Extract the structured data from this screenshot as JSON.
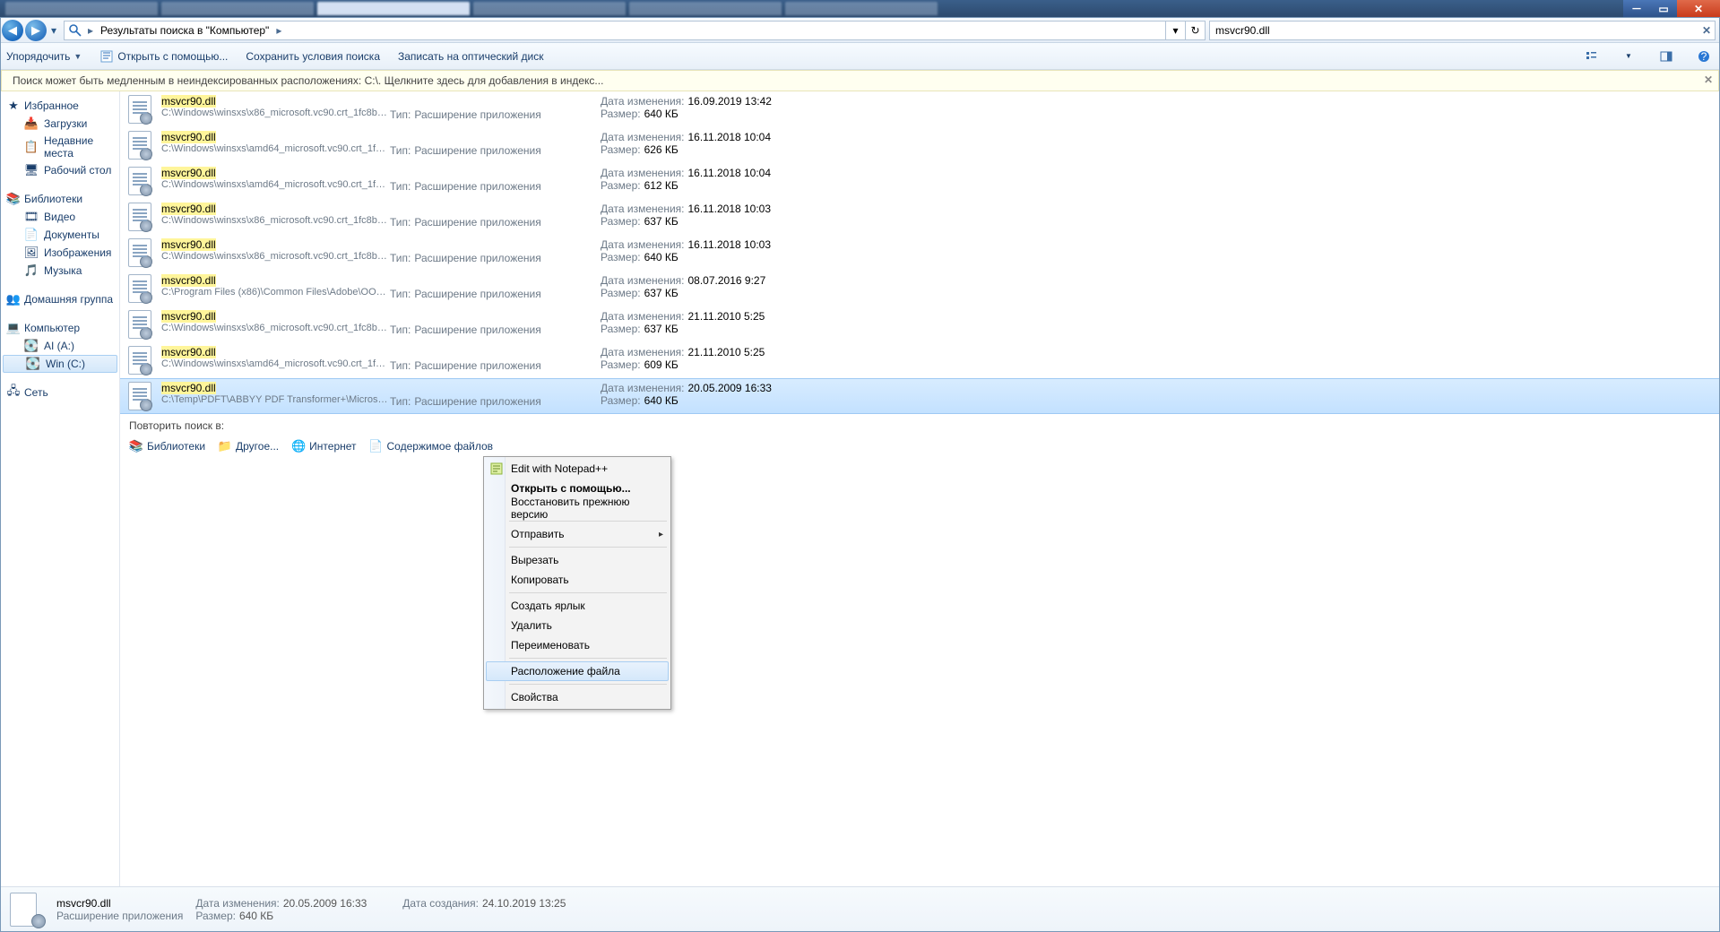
{
  "breadcrumb": {
    "text": "Результаты поиска в \"Компьютер\""
  },
  "search": {
    "value": "msvcr90.dll"
  },
  "toolbar": {
    "organize": "Упорядочить",
    "open_with": "Открыть с помощью...",
    "save_search": "Сохранить условия поиска",
    "burn": "Записать на оптический диск"
  },
  "infobar": {
    "text": "Поиск может быть медленным в неиндексированных расположениях: C:\\. Щелкните здесь для добавления в индекс..."
  },
  "sidebar": {
    "favorites": {
      "label": "Избранное",
      "items": [
        {
          "label": "Загрузки"
        },
        {
          "label": "Недавние места"
        },
        {
          "label": "Рабочий стол"
        }
      ]
    },
    "libraries": {
      "label": "Библиотеки",
      "items": [
        {
          "label": "Видео"
        },
        {
          "label": "Документы"
        },
        {
          "label": "Изображения"
        },
        {
          "label": "Музыка"
        }
      ]
    },
    "homegroup": {
      "label": "Домашняя группа"
    },
    "computer": {
      "label": "Компьютер",
      "items": [
        {
          "label": "AI (A:)"
        },
        {
          "label": "Win (C:)",
          "selected": true
        }
      ]
    },
    "network": {
      "label": "Сеть"
    }
  },
  "type_label": "Тип:",
  "type_value": "Расширение приложения",
  "date_label": "Дата изменения:",
  "size_label": "Размер:",
  "results": [
    {
      "name": "msvcr90.dll",
      "path": "C:\\Windows\\winsxs\\x86_microsoft.vc90.crt_1fc8b3b...",
      "date": "16.09.2019 13:42",
      "size": "640 КБ"
    },
    {
      "name": "msvcr90.dll",
      "path": "C:\\Windows\\winsxs\\amd64_microsoft.vc90.crt_1fc8...",
      "date": "16.11.2018 10:04",
      "size": "626 КБ"
    },
    {
      "name": "msvcr90.dll",
      "path": "C:\\Windows\\winsxs\\amd64_microsoft.vc90.crt_1fc8...",
      "date": "16.11.2018 10:04",
      "size": "612 КБ"
    },
    {
      "name": "msvcr90.dll",
      "path": "C:\\Windows\\winsxs\\x86_microsoft.vc90.crt_1fc8b3b...",
      "date": "16.11.2018 10:03",
      "size": "637 КБ"
    },
    {
      "name": "msvcr90.dll",
      "path": "C:\\Windows\\winsxs\\x86_microsoft.vc90.crt_1fc8b3b...",
      "date": "16.11.2018 10:03",
      "size": "640 КБ"
    },
    {
      "name": "msvcr90.dll",
      "path": "C:\\Program Files (x86)\\Common Files\\Adobe\\OOBE...",
      "date": "08.07.2016 9:27",
      "size": "637 КБ"
    },
    {
      "name": "msvcr90.dll",
      "path": "C:\\Windows\\winsxs\\x86_microsoft.vc90.crt_1fc8b3b...",
      "date": "21.11.2010 5:25",
      "size": "637 КБ"
    },
    {
      "name": "msvcr90.dll",
      "path": "C:\\Windows\\winsxs\\amd64_microsoft.vc90.crt_1fc8...",
      "date": "21.11.2010 5:25",
      "size": "609 КБ"
    },
    {
      "name": "msvcr90.dll",
      "path": "C:\\Temp\\PDFT\\ABBYY PDF Transformer+\\Microsoft...",
      "date": "20.05.2009 16:33",
      "size": "640 КБ",
      "selected": true
    }
  ],
  "repeat": {
    "label": "Повторить поиск в:",
    "links": [
      "Библиотеки",
      "Другое...",
      "Интернет",
      "Содержимое файлов"
    ]
  },
  "context_menu": [
    {
      "label": "Edit with Notepad++",
      "icon": true
    },
    {
      "label": "Открыть с помощью...",
      "bold": true
    },
    {
      "label": "Восстановить прежнюю версию"
    },
    {
      "sep": true
    },
    {
      "label": "Отправить",
      "submenu": true
    },
    {
      "sep": true
    },
    {
      "label": "Вырезать"
    },
    {
      "label": "Копировать"
    },
    {
      "sep": true
    },
    {
      "label": "Создать ярлык"
    },
    {
      "label": "Удалить"
    },
    {
      "label": "Переименовать"
    },
    {
      "sep": true
    },
    {
      "label": "Расположение файла",
      "hover": true
    },
    {
      "sep": true
    },
    {
      "label": "Свойства"
    }
  ],
  "details": {
    "name": "msvcr90.dll",
    "type": "Расширение приложения",
    "date_mod_label": "Дата изменения:",
    "date_mod": "20.05.2009 16:33",
    "size_label": "Размер:",
    "size": "640 КБ",
    "date_created_label": "Дата создания:",
    "date_created": "24.10.2019 13:25"
  }
}
